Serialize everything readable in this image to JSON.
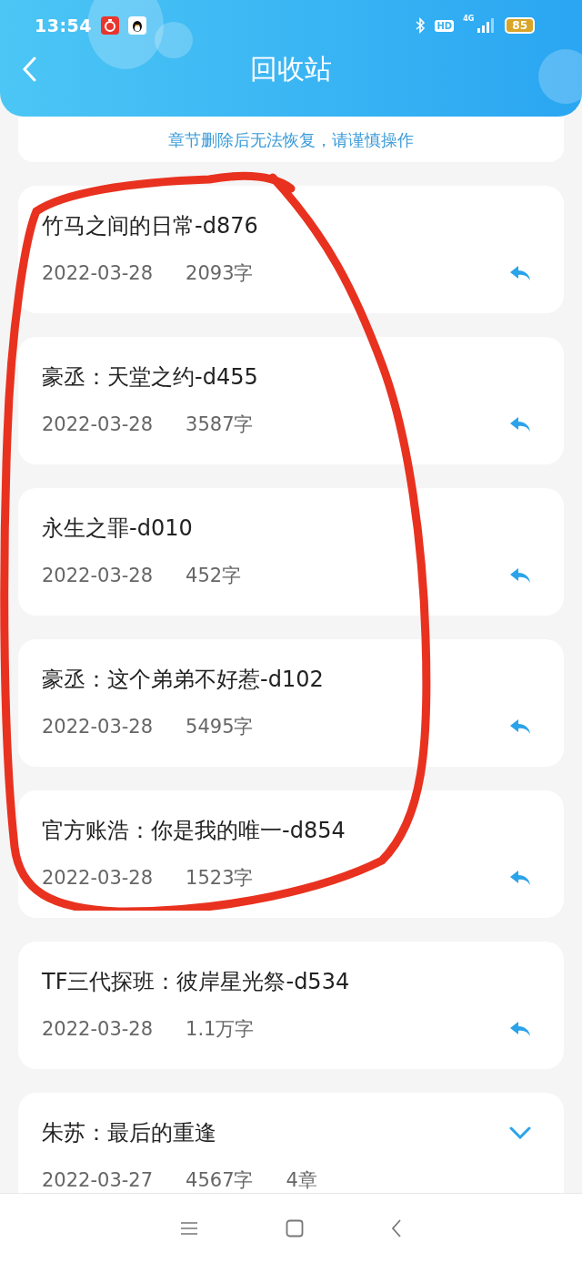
{
  "status_bar": {
    "time": "13:54",
    "battery": "85",
    "hd": "HD",
    "network": "4G"
  },
  "header": {
    "title": "回收站"
  },
  "notice": "章节删除后无法恢复，请谨慎操作",
  "items": [
    {
      "kind": "chapter",
      "title": "竹马之间的日常-d876",
      "date": "2022-03-28",
      "words": "2093字"
    },
    {
      "kind": "chapter",
      "title": "豪丞：天堂之约-d455",
      "date": "2022-03-28",
      "words": "3587字"
    },
    {
      "kind": "chapter",
      "title": "永生之罪-d010",
      "date": "2022-03-28",
      "words": "452字"
    },
    {
      "kind": "chapter",
      "title": "豪丞：这个弟弟不好惹-d102",
      "date": "2022-03-28",
      "words": "5495字"
    },
    {
      "kind": "chapter",
      "title": "官方账浩：你是我的唯一-d854",
      "date": "2022-03-28",
      "words": "1523字"
    },
    {
      "kind": "chapter",
      "title": "TF三代探班：彼岸星光祭-d534",
      "date": "2022-03-28",
      "words": "1.1万字"
    },
    {
      "kind": "book",
      "title": "朱苏：最后的重逢",
      "date": "2022-03-27",
      "words": "4567字",
      "chapters": "4章",
      "expanded": false
    }
  ]
}
